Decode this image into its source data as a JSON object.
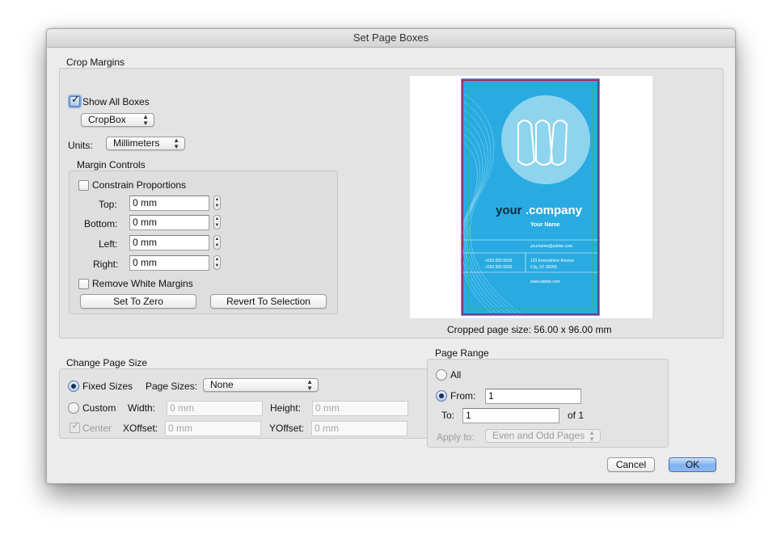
{
  "dialog": {
    "title": "Set Page Boxes"
  },
  "crop_margins": {
    "group_label": "Crop Margins",
    "show_all_boxes": {
      "label": "Show All Boxes",
      "checked": true
    },
    "box_select": {
      "value": "CropBox"
    },
    "units": {
      "label": "Units:",
      "value": "Millimeters"
    },
    "margin_controls": {
      "label": "Margin Controls",
      "constrain_proportions": {
        "label": "Constrain Proportions",
        "checked": false
      },
      "top": {
        "label": "Top:",
        "value": "0 mm"
      },
      "bottom": {
        "label": "Bottom:",
        "value": "0 mm"
      },
      "left": {
        "label": "Left:",
        "value": "0 mm"
      },
      "right": {
        "label": "Right:",
        "value": "0 mm"
      },
      "remove_white_margins": {
        "label": "Remove White Margins",
        "checked": false
      },
      "set_to_zero_label": "Set To Zero",
      "revert_label": "Revert To Selection"
    },
    "preview": {
      "company_your": "your",
      "company_name": ".company",
      "person": "Your Name",
      "email": "yourname@adobe.com",
      "phone1": "+555.555.5555",
      "phone2": "+555.555.5555",
      "address1": "123 Everywhere Avenue",
      "address2": "City, ST 00000",
      "web": "www.adobe.com"
    },
    "cropped_size": "Cropped page size: 56.00 x 96.00 mm"
  },
  "change_page_size": {
    "group_label": "Change Page Size",
    "fixed_sizes": {
      "label": "Fixed Sizes",
      "selected": true
    },
    "page_sizes": {
      "label": "Page Sizes:",
      "value": "None"
    },
    "custom": {
      "label": "Custom",
      "selected": false
    },
    "width": {
      "label": "Width:",
      "placeholder": "0 mm"
    },
    "height": {
      "label": "Height:",
      "placeholder": "0 mm"
    },
    "center": {
      "label": "Center",
      "checked": true
    },
    "xoffset": {
      "label": "XOffset:",
      "placeholder": "0 mm"
    },
    "yoffset": {
      "label": "YOffset:",
      "placeholder": "0 mm"
    }
  },
  "page_range": {
    "group_label": "Page Range",
    "all": {
      "label": "All",
      "selected": false
    },
    "from": {
      "label": "From:",
      "value": "1",
      "selected": true
    },
    "to": {
      "label": "To:",
      "value": "1"
    },
    "of_label": "of 1",
    "apply_to": {
      "label": "Apply to:",
      "value": "Even and Odd Pages"
    }
  },
  "actions": {
    "cancel": "Cancel",
    "ok": "OK"
  },
  "colors": {
    "card_blue": "#29abe2",
    "default_button": "#7fb0f0",
    "crop_line_red": "#c0143c",
    "bleed_line_green": "#22c44a"
  }
}
